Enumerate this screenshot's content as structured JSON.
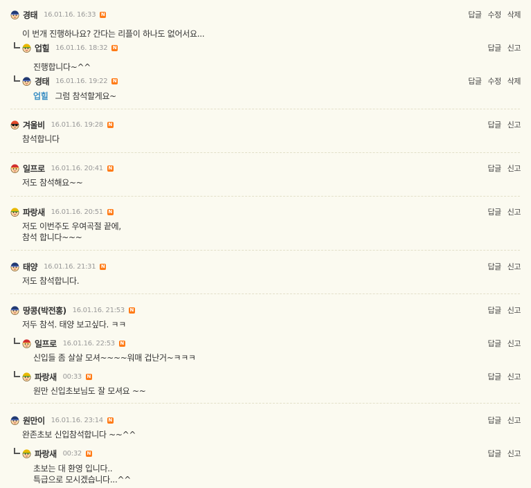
{
  "comments": [
    {
      "nick": "경태",
      "date": "16.01.16. 16:33",
      "new": "N",
      "actions": [
        "답글",
        "수정",
        "삭제"
      ],
      "lines": [
        "이 번개 진행하나요? 간다는 리플이 하나도 없어서요..."
      ],
      "avatar": "navy"
    },
    {
      "nick": "업힐",
      "date": "16.01.16. 18:32",
      "new": "N",
      "actions": [
        "답글",
        "신고"
      ],
      "lines": [
        "진행합니다~^^"
      ],
      "avatar": "yellow"
    },
    {
      "nick": "경태",
      "date": "16.01.16. 19:22",
      "new": "N",
      "actions": [
        "답글",
        "수정",
        "삭제"
      ],
      "mention": "업힐",
      "lines": [
        "그럼 참석할게요~"
      ],
      "avatar": "navy"
    },
    {
      "nick": "겨울비",
      "date": "16.01.16. 19:28",
      "new": "N",
      "actions": [
        "답글",
        "신고"
      ],
      "lines": [
        "참석합니다"
      ],
      "avatar": "sunglasses"
    },
    {
      "nick": "일프로",
      "date": "16.01.16. 20:41",
      "new": "N",
      "actions": [
        "답글",
        "신고"
      ],
      "lines": [
        "저도 참석해요~~"
      ],
      "avatar": "red"
    },
    {
      "nick": "파랑새",
      "date": "16.01.16. 20:51",
      "new": "N",
      "actions": [
        "답글",
        "신고"
      ],
      "lines": [
        "저도 이번주도 우여곡절 끝에,",
        "참석 합니다~~~"
      ],
      "avatar": "yellow"
    },
    {
      "nick": "태양",
      "date": "16.01.16. 21:31",
      "new": "N",
      "actions": [
        "답글",
        "신고"
      ],
      "lines": [
        "저도 참석합니다."
      ],
      "avatar": "navy"
    },
    {
      "nick": "땅콩(박전홍)",
      "date": "16.01.16. 21:53",
      "new": "N",
      "actions": [
        "답글",
        "신고"
      ],
      "lines": [
        "저두 참석. 태양 보고싶다. ㅋㅋ"
      ],
      "avatar": "navy"
    },
    {
      "nick": "일프로",
      "date": "16.01.16. 22:53",
      "new": "N",
      "actions": [
        "답글",
        "신고"
      ],
      "lines": [
        "신입들 좀 살살 모셔~~~~워매 겁난거~ㅋㅋㅋ"
      ],
      "avatar": "red"
    },
    {
      "nick": "파랑새",
      "date": "00:33",
      "new": "N",
      "actions": [
        "답글",
        "신고"
      ],
      "lines": [
        "원만 신입초보님도 잘 모셔요 ~~"
      ],
      "avatar": "yellow"
    },
    {
      "nick": "원만이",
      "date": "16.01.16. 23:14",
      "new": "N",
      "actions": [
        "답글",
        "신고"
      ],
      "lines": [
        "완존초보 신입참석합니다 ~~^^"
      ],
      "avatar": "navy"
    },
    {
      "nick": "파랑새",
      "date": "00:32",
      "new": "N",
      "actions": [
        "답글",
        "신고"
      ],
      "lines": [
        "초보는 대 환영 입니다..",
        "특급으로 모시겠습니다...^^"
      ],
      "avatar": "yellow"
    }
  ]
}
